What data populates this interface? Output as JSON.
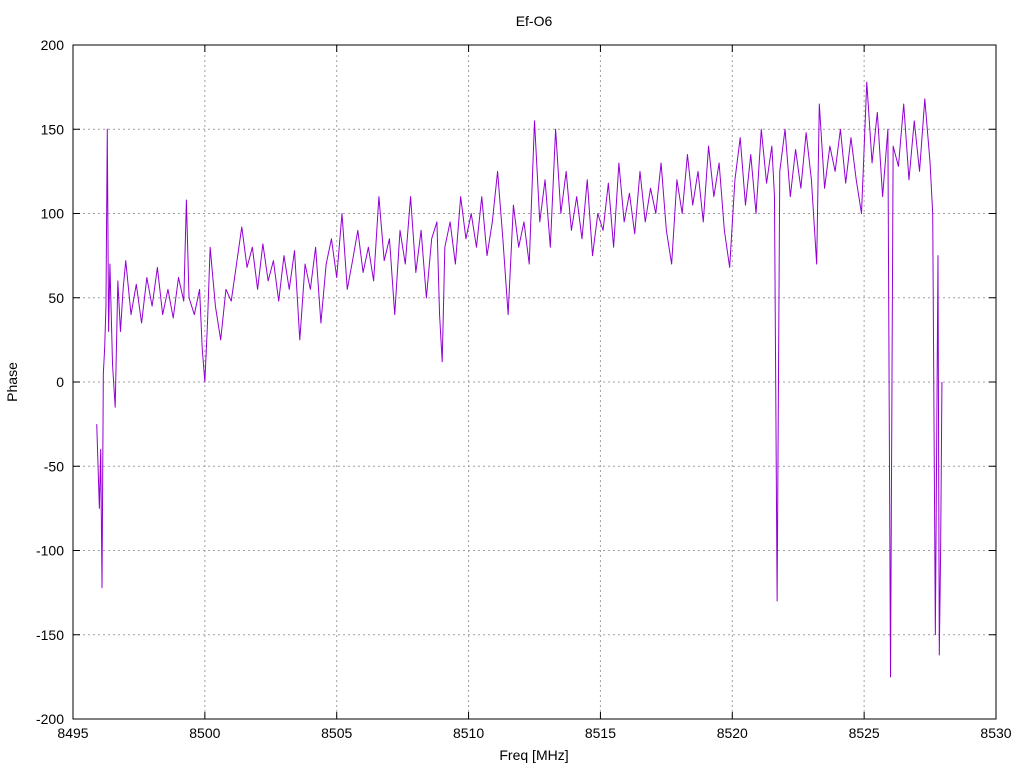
{
  "chart_data": {
    "type": "line",
    "title": "Ef-O6",
    "xlabel": "Freq [MHz]",
    "ylabel": "Phase",
    "xlim": [
      8495,
      8530
    ],
    "ylim": [
      -200,
      200
    ],
    "x_ticks": [
      8495,
      8500,
      8505,
      8510,
      8515,
      8520,
      8525,
      8530
    ],
    "y_ticks": [
      -200,
      -150,
      -100,
      -50,
      0,
      50,
      100,
      150,
      200
    ],
    "grid": true,
    "legend": "none",
    "series": [
      {
        "color": "#9400d3",
        "points": [
          [
            8495.9,
            -25
          ],
          [
            8496.0,
            -75
          ],
          [
            8496.05,
            -40
          ],
          [
            8496.1,
            -122
          ],
          [
            8496.15,
            5
          ],
          [
            8496.2,
            20
          ],
          [
            8496.25,
            45
          ],
          [
            8496.3,
            150
          ],
          [
            8496.35,
            30
          ],
          [
            8496.4,
            70
          ],
          [
            8496.5,
            10
          ],
          [
            8496.6,
            -15
          ],
          [
            8496.7,
            60
          ],
          [
            8496.8,
            30
          ],
          [
            8496.9,
            55
          ],
          [
            8497.0,
            72
          ],
          [
            8497.2,
            40
          ],
          [
            8497.4,
            58
          ],
          [
            8497.6,
            35
          ],
          [
            8497.8,
            62
          ],
          [
            8498.0,
            45
          ],
          [
            8498.2,
            68
          ],
          [
            8498.4,
            40
          ],
          [
            8498.6,
            55
          ],
          [
            8498.8,
            38
          ],
          [
            8499.0,
            62
          ],
          [
            8499.2,
            48
          ],
          [
            8499.3,
            108
          ],
          [
            8499.4,
            50
          ],
          [
            8499.6,
            40
          ],
          [
            8499.8,
            55
          ],
          [
            8499.9,
            20
          ],
          [
            8500.0,
            0
          ],
          [
            8500.1,
            35
          ],
          [
            8500.2,
            80
          ],
          [
            8500.4,
            45
          ],
          [
            8500.6,
            25
          ],
          [
            8500.8,
            55
          ],
          [
            8501.0,
            48
          ],
          [
            8501.2,
            70
          ],
          [
            8501.4,
            92
          ],
          [
            8501.6,
            68
          ],
          [
            8501.8,
            80
          ],
          [
            8502.0,
            55
          ],
          [
            8502.2,
            82
          ],
          [
            8502.4,
            60
          ],
          [
            8502.6,
            72
          ],
          [
            8502.8,
            48
          ],
          [
            8503.0,
            75
          ],
          [
            8503.2,
            55
          ],
          [
            8503.4,
            78
          ],
          [
            8503.6,
            25
          ],
          [
            8503.8,
            70
          ],
          [
            8504.0,
            55
          ],
          [
            8504.2,
            80
          ],
          [
            8504.4,
            35
          ],
          [
            8504.6,
            70
          ],
          [
            8504.8,
            85
          ],
          [
            8505.0,
            62
          ],
          [
            8505.2,
            100
          ],
          [
            8505.4,
            55
          ],
          [
            8505.6,
            72
          ],
          [
            8505.8,
            90
          ],
          [
            8506.0,
            65
          ],
          [
            8506.2,
            80
          ],
          [
            8506.4,
            60
          ],
          [
            8506.6,
            110
          ],
          [
            8506.8,
            72
          ],
          [
            8507.0,
            85
          ],
          [
            8507.2,
            40
          ],
          [
            8507.4,
            90
          ],
          [
            8507.6,
            70
          ],
          [
            8507.8,
            110
          ],
          [
            8508.0,
            65
          ],
          [
            8508.2,
            90
          ],
          [
            8508.4,
            50
          ],
          [
            8508.6,
            85
          ],
          [
            8508.8,
            95
          ],
          [
            8508.9,
            40
          ],
          [
            8509.0,
            12
          ],
          [
            8509.1,
            80
          ],
          [
            8509.3,
            95
          ],
          [
            8509.5,
            70
          ],
          [
            8509.7,
            110
          ],
          [
            8509.9,
            85
          ],
          [
            8510.1,
            100
          ],
          [
            8510.3,
            80
          ],
          [
            8510.5,
            110
          ],
          [
            8510.7,
            75
          ],
          [
            8510.9,
            95
          ],
          [
            8511.1,
            125
          ],
          [
            8511.3,
            85
          ],
          [
            8511.5,
            40
          ],
          [
            8511.7,
            105
          ],
          [
            8511.9,
            80
          ],
          [
            8512.1,
            95
          ],
          [
            8512.3,
            70
          ],
          [
            8512.5,
            155
          ],
          [
            8512.7,
            95
          ],
          [
            8512.9,
            120
          ],
          [
            8513.1,
            80
          ],
          [
            8513.3,
            150
          ],
          [
            8513.5,
            100
          ],
          [
            8513.7,
            125
          ],
          [
            8513.9,
            90
          ],
          [
            8514.1,
            110
          ],
          [
            8514.3,
            85
          ],
          [
            8514.5,
            120
          ],
          [
            8514.7,
            75
          ],
          [
            8514.9,
            100
          ],
          [
            8515.1,
            90
          ],
          [
            8515.3,
            118
          ],
          [
            8515.5,
            80
          ],
          [
            8515.7,
            130
          ],
          [
            8515.9,
            95
          ],
          [
            8516.1,
            112
          ],
          [
            8516.3,
            88
          ],
          [
            8516.5,
            125
          ],
          [
            8516.7,
            95
          ],
          [
            8516.9,
            115
          ],
          [
            8517.1,
            100
          ],
          [
            8517.3,
            130
          ],
          [
            8517.5,
            90
          ],
          [
            8517.7,
            70
          ],
          [
            8517.9,
            120
          ],
          [
            8518.1,
            100
          ],
          [
            8518.3,
            135
          ],
          [
            8518.5,
            105
          ],
          [
            8518.7,
            125
          ],
          [
            8518.9,
            95
          ],
          [
            8519.1,
            140
          ],
          [
            8519.3,
            110
          ],
          [
            8519.5,
            130
          ],
          [
            8519.7,
            90
          ],
          [
            8519.9,
            68
          ],
          [
            8520.1,
            120
          ],
          [
            8520.3,
            145
          ],
          [
            8520.5,
            105
          ],
          [
            8520.7,
            135
          ],
          [
            8520.9,
            100
          ],
          [
            8521.1,
            150
          ],
          [
            8521.3,
            118
          ],
          [
            8521.5,
            140
          ],
          [
            8521.6,
            110
          ],
          [
            8521.7,
            -130
          ],
          [
            8521.8,
            125
          ],
          [
            8522.0,
            150
          ],
          [
            8522.2,
            110
          ],
          [
            8522.4,
            138
          ],
          [
            8522.6,
            115
          ],
          [
            8522.8,
            148
          ],
          [
            8523.0,
            120
          ],
          [
            8523.2,
            70
          ],
          [
            8523.3,
            165
          ],
          [
            8523.5,
            115
          ],
          [
            8523.7,
            140
          ],
          [
            8523.9,
            125
          ],
          [
            8524.1,
            150
          ],
          [
            8524.3,
            118
          ],
          [
            8524.5,
            145
          ],
          [
            8524.7,
            120
          ],
          [
            8524.9,
            100
          ],
          [
            8525.1,
            178
          ],
          [
            8525.3,
            130
          ],
          [
            8525.5,
            160
          ],
          [
            8525.7,
            110
          ],
          [
            8525.9,
            150
          ],
          [
            8526.0,
            -175
          ],
          [
            8526.1,
            140
          ],
          [
            8526.3,
            128
          ],
          [
            8526.5,
            165
          ],
          [
            8526.7,
            120
          ],
          [
            8526.9,
            155
          ],
          [
            8527.1,
            125
          ],
          [
            8527.3,
            168
          ],
          [
            8527.5,
            130
          ],
          [
            8527.6,
            100
          ],
          [
            8527.7,
            -150
          ],
          [
            8527.8,
            75
          ],
          [
            8527.85,
            -162
          ],
          [
            8527.9,
            -100
          ],
          [
            8527.95,
            0
          ]
        ]
      }
    ]
  }
}
